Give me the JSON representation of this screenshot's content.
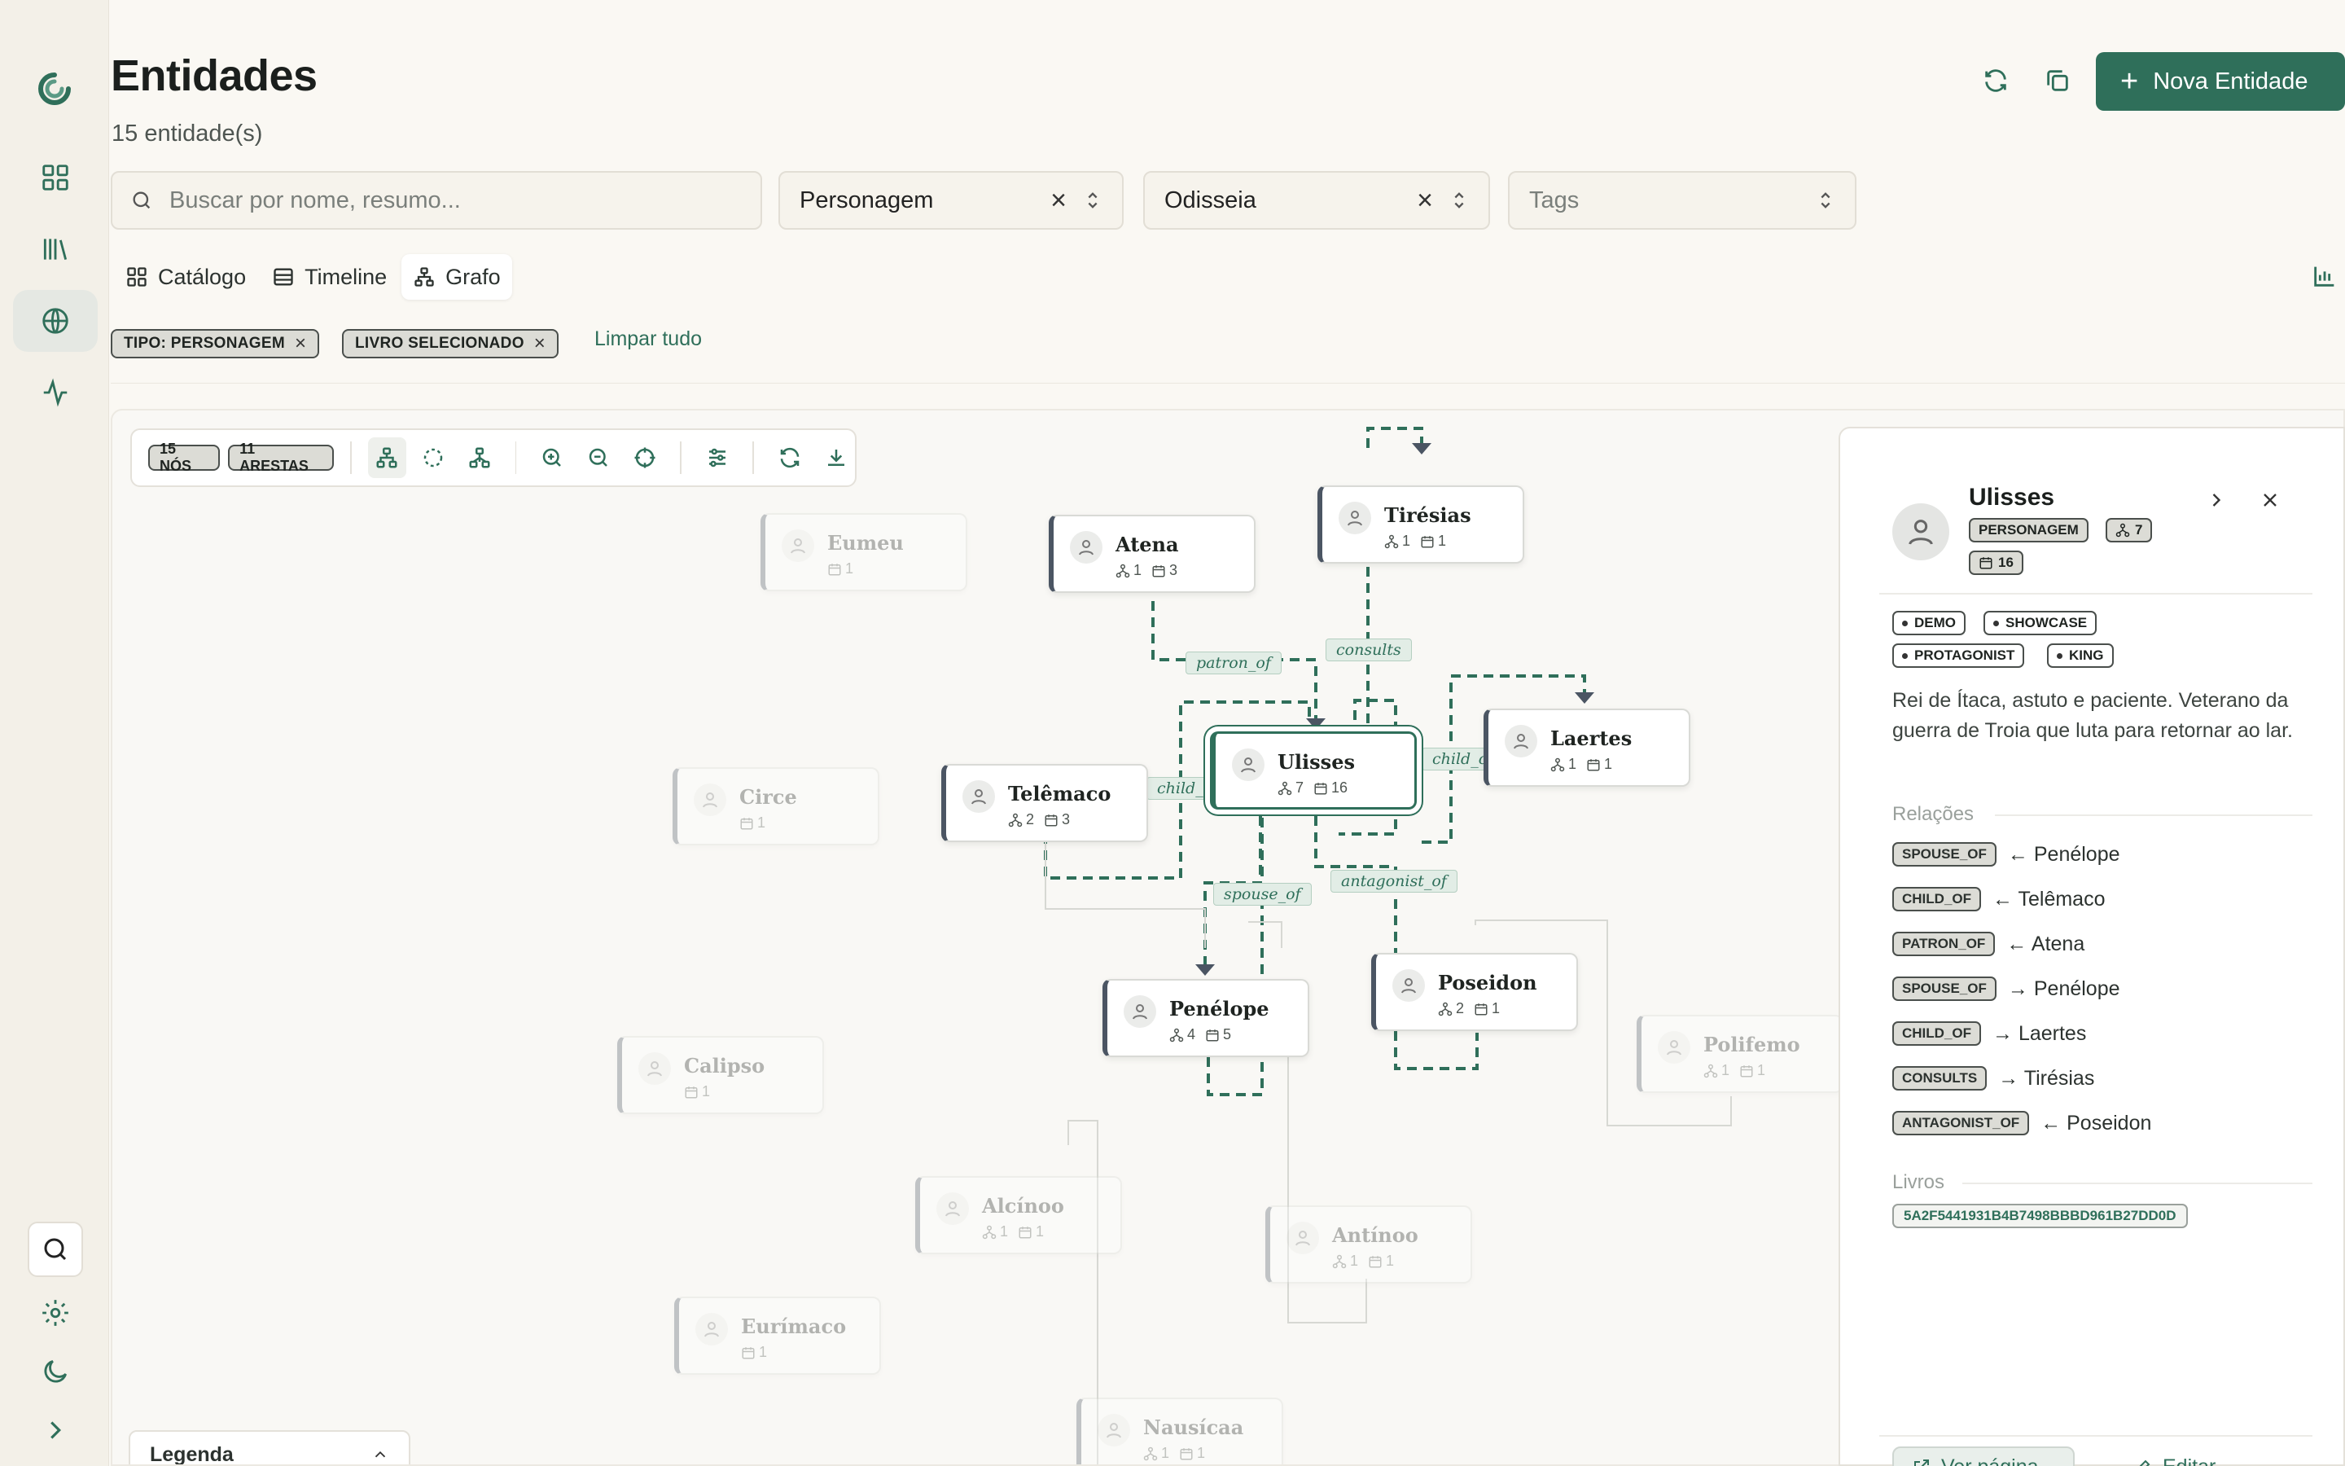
{
  "header": {
    "title": "Entidades",
    "count": "15 entidade(s)",
    "new_button": "Nova Entidade"
  },
  "filters": {
    "search_placeholder": "Buscar por nome, resumo...",
    "type_value": "Personagem",
    "book_value": "Odisseia",
    "tags_placeholder": "Tags"
  },
  "tabs": [
    {
      "label": "Catálogo"
    },
    {
      "label": "Timeline"
    },
    {
      "label": "Grafo"
    }
  ],
  "active_filters": {
    "chips": [
      "TIPO: PERSONAGEM",
      "LIVRO SELECIONADO"
    ],
    "clear_all": "Limpar tudo"
  },
  "graph": {
    "nodes_badge": "15 NÓS",
    "edges_badge": "11 ARESTAS",
    "legend_label": "Legenda",
    "accent_color": "#2f6f5a",
    "nodes": [
      {
        "id": "ulisses",
        "name": "Ulisses",
        "rels": "7",
        "books": "16",
        "state": "selected"
      },
      {
        "id": "atena",
        "name": "Atena",
        "rels": "1",
        "books": "3",
        "state": "normal"
      },
      {
        "id": "tiresias",
        "name": "Tirésias",
        "rels": "1",
        "books": "1",
        "state": "normal"
      },
      {
        "id": "laertes",
        "name": "Laertes",
        "rels": "1",
        "books": "1",
        "state": "normal"
      },
      {
        "id": "telemaco",
        "name": "Telêmaco",
        "rels": "2",
        "books": "3",
        "state": "normal"
      },
      {
        "id": "penelope",
        "name": "Penélope",
        "rels": "4",
        "books": "5",
        "state": "normal"
      },
      {
        "id": "poseidon",
        "name": "Poseidon",
        "rels": "2",
        "books": "1",
        "state": "normal"
      },
      {
        "id": "eumeu",
        "name": "Eumeu",
        "rels": "",
        "books": "1",
        "state": "faded"
      },
      {
        "id": "circe",
        "name": "Circe",
        "rels": "",
        "books": "1",
        "state": "faded"
      },
      {
        "id": "calipso",
        "name": "Calipso",
        "rels": "",
        "books": "1",
        "state": "faded"
      },
      {
        "id": "polifemo",
        "name": "Polifemo",
        "rels": "1",
        "books": "1",
        "state": "faded"
      },
      {
        "id": "alcinoo",
        "name": "Alcínoo",
        "rels": "1",
        "books": "1",
        "state": "faded"
      },
      {
        "id": "antinoo",
        "name": "Antínoo",
        "rels": "1",
        "books": "1",
        "state": "faded"
      },
      {
        "id": "eurimaco",
        "name": "Eurímaco",
        "rels": "",
        "books": "1",
        "state": "faded"
      },
      {
        "id": "nausicaa",
        "name": "Nausícaa",
        "rels": "1",
        "books": "1",
        "state": "faded"
      }
    ],
    "edge_labels": {
      "patron_of": "patron_of",
      "consults": "consults",
      "child_of_left": "child_o",
      "child_of_right": "child_of",
      "spouse_of": "spouse_of",
      "antagonist_of": "antagonist_of"
    }
  },
  "panel": {
    "name": "Ulisses",
    "type_badge": "PERSONAGEM",
    "rels_count": "7",
    "books_count": "16",
    "tags": [
      "DEMO",
      "SHOWCASE",
      "PROTAGONIST",
      "KING"
    ],
    "description": "Rei de Ítaca, astuto e paciente. Veterano da guerra de Troia que luta para retornar ao lar.",
    "relations_title": "Relações",
    "relations": [
      {
        "type": "SPOUSE_OF",
        "target": "← Penélope"
      },
      {
        "type": "CHILD_OF",
        "target": "← Telêmaco"
      },
      {
        "type": "PATRON_OF",
        "target": "← Atena"
      },
      {
        "type": "SPOUSE_OF",
        "target": "→ Penélope"
      },
      {
        "type": "CHILD_OF",
        "target": "→ Laertes"
      },
      {
        "type": "CONSULTS",
        "target": "→ Tirésias"
      },
      {
        "type": "ANTAGONIST_OF",
        "target": "← Poseidon"
      }
    ],
    "books_title": "Livros",
    "book_id": "5A2F5441931B4B7498BBBD961B27DD0D",
    "view_page": "Ver página",
    "edit": "Editar"
  }
}
